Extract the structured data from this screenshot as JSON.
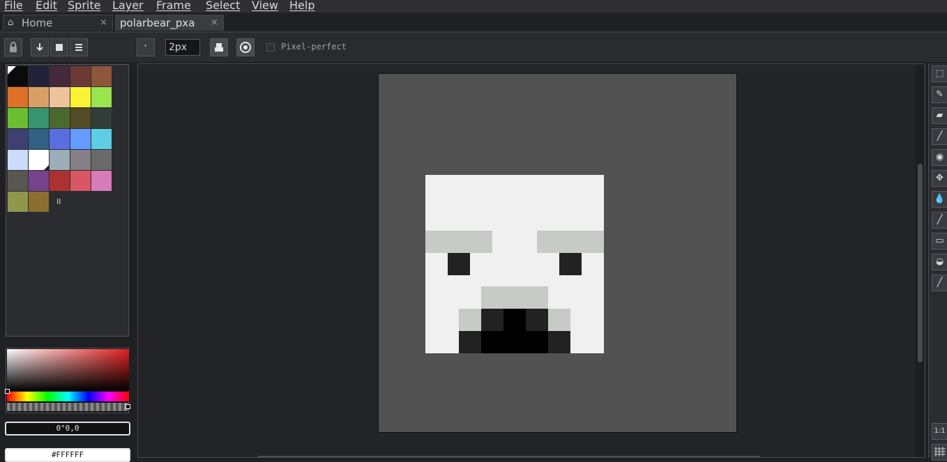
{
  "menu": {
    "items": [
      "File",
      "Edit",
      "Sprite",
      "Layer",
      "Frame",
      "Select",
      "View",
      "Help"
    ]
  },
  "tabs": {
    "home": {
      "icon": "home-icon",
      "label": "Home",
      "close": "×"
    },
    "file": {
      "label": "polarbear_pxa",
      "close": "×"
    }
  },
  "toolbar": {
    "brush_size": "2px",
    "pixel_perfect_label": "Pixel-perfect",
    "pixel_perfect_checked": false,
    "brush_dot": "·"
  },
  "palette": {
    "colors": [
      "#0b0b0e",
      "#22223a",
      "#44283c",
      "#6b3a33",
      "#8f563b",
      "#df7126",
      "#d9a066",
      "#eec39a",
      "#fbf236",
      "#99e550",
      "#6abe30",
      "#37946e",
      "#4b692f",
      "#524b24",
      "#323c39",
      "#3f3f74",
      "#306082",
      "#5b6ee1",
      "#639bff",
      "#5fcde4",
      "#cbdbfc",
      "#ffffff",
      "#9badb7",
      "#847e87",
      "#696a6a",
      "#595652",
      "#76428a",
      "#ac3232",
      "#d95763",
      "#d77bba",
      "#8f974a",
      "#8a6f30"
    ],
    "pause_label": "II",
    "selected_index": 21
  },
  "color": {
    "hsv_text": "0°0,0",
    "hex_text": "#FFFFFF"
  },
  "tools": {
    "labels": [
      "⬚",
      "✎",
      "▰",
      "╱",
      "◉",
      "✥",
      "💧",
      "╱",
      "▭",
      "◒",
      "╱"
    ],
    "zoom_label": "1:1",
    "names": [
      "marquee-icon",
      "pencil-icon",
      "eraser-icon",
      "eyedropper-icon",
      "zoom-icon",
      "move-icon",
      "fill-icon",
      "line-icon",
      "rectangle-icon",
      "blur-icon",
      "spray-icon"
    ]
  },
  "sprite": {
    "colors": {
      "bg": "#525252",
      "fur": "#f0f0f0",
      "shade": "#c7cac7",
      "dark": "#222222",
      "black": "#000000"
    },
    "grid_size": 16,
    "face": [
      "................",
      "................",
      "................",
      "................",
      "................",
      "................",
      "................",
      "................",
      "................",
      "................",
      "................",
      "................",
      "................",
      "................",
      "................",
      "................"
    ]
  }
}
